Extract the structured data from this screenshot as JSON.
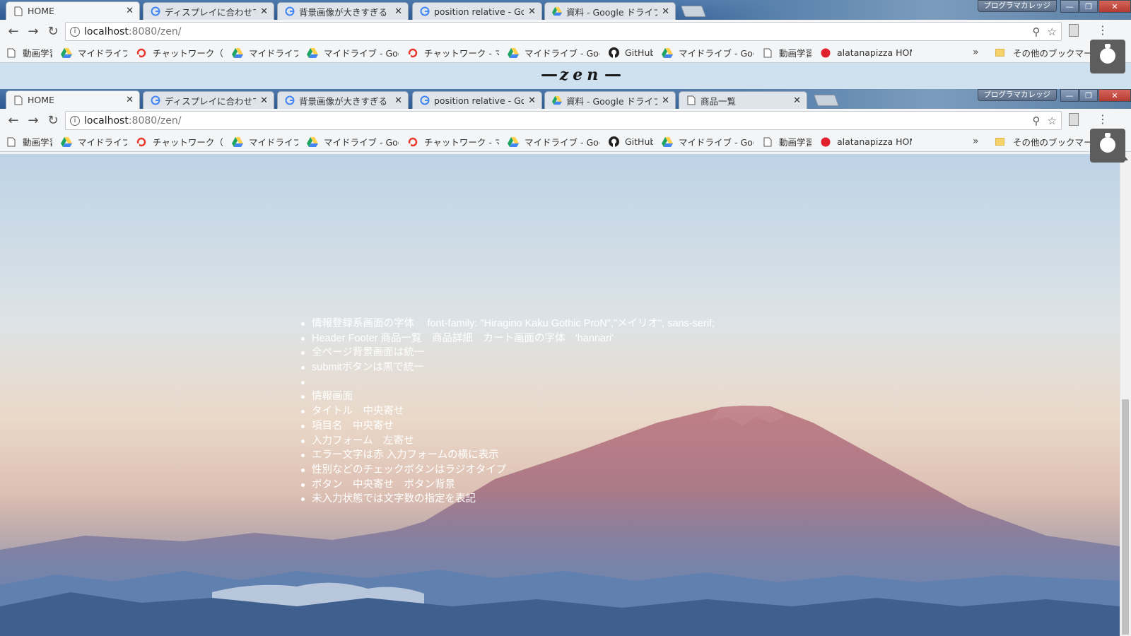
{
  "browser": {
    "tabs_top": [
      {
        "title": "HOME",
        "favicon": "page-icon",
        "active": true
      },
      {
        "title": "ディスプレイに合わせて",
        "favicon": "google-icon",
        "active": false
      },
      {
        "title": "背景画像が大きすぎる -",
        "favicon": "google-icon",
        "active": false
      },
      {
        "title": "position relative - Goo",
        "favicon": "google-icon",
        "active": false
      },
      {
        "title": "資料 - Google ドライブ",
        "favicon": "drive-icon",
        "active": false
      }
    ],
    "tabs_second": [
      {
        "title": "HOME",
        "favicon": "page-icon",
        "active": true
      },
      {
        "title": "ディスプレイに合わせて",
        "favicon": "google-icon",
        "active": false
      },
      {
        "title": "背景画像が大きすぎる -",
        "favicon": "google-icon",
        "active": false
      },
      {
        "title": "position relative - Goo",
        "favicon": "google-icon",
        "active": false
      },
      {
        "title": "資料 - Google ドライブ",
        "favicon": "drive-icon",
        "active": false
      },
      {
        "title": "商品一覧",
        "favicon": "page-icon",
        "active": false
      }
    ],
    "profile_name": "プログラマカレッジ",
    "url_host": "localhost",
    "url_path": ":8080/zen/",
    "bookmarks": [
      {
        "label": "動画学習",
        "icon": "page-icon"
      },
      {
        "label": "マイドライブ",
        "icon": "drive-icon"
      },
      {
        "label": "チャットワーク（Ch",
        "icon": "chatwork-icon"
      },
      {
        "label": "マイドライブ",
        "icon": "drive-icon"
      },
      {
        "label": "マイドライブ - Goo",
        "icon": "drive-icon"
      },
      {
        "label": "チャットワーク - マ",
        "icon": "chatwork-icon"
      },
      {
        "label": "マイドライブ - Goo",
        "icon": "drive-icon"
      },
      {
        "label": "GitHub",
        "icon": "github-icon"
      },
      {
        "label": "マイドライブ - Goo",
        "icon": "drive-icon"
      },
      {
        "label": "動画学習",
        "icon": "page-icon"
      },
      {
        "label": "alatanapizza HOME",
        "icon": "red-dot-icon"
      }
    ],
    "bookmarks_more": "»",
    "other_bookmarks": "その他のブックマーク",
    "colors": {
      "accent_red": "#e8362c",
      "drive_green": "#1fa463",
      "drive_yellow": "#ffd04b",
      "drive_blue": "#4285f4"
    }
  },
  "site": {
    "logo_text": "zen"
  },
  "notes": [
    "情報登録系画面の字体　 font-family: \"Hiragino Kaku Gothic ProN\",\"メイリオ\", sans-serif;",
    "Header Footer 商品一覧　商品詳細　カート画面の字体　'hannari'",
    "全ページ背景画面は統一",
    "submitボタンは黒で統一",
    "",
    "情報画面",
    "タイトル　中央寄せ",
    "項目名　中央寄せ",
    "入力フォーム　左寄せ",
    "エラー文字は赤 入力フォームの横に表示",
    "性別などのチェックボタンはラジオタイプ",
    "ボタン　中央寄せ　ボタン背景",
    "未入力状態では文字数の指定を表記"
  ]
}
